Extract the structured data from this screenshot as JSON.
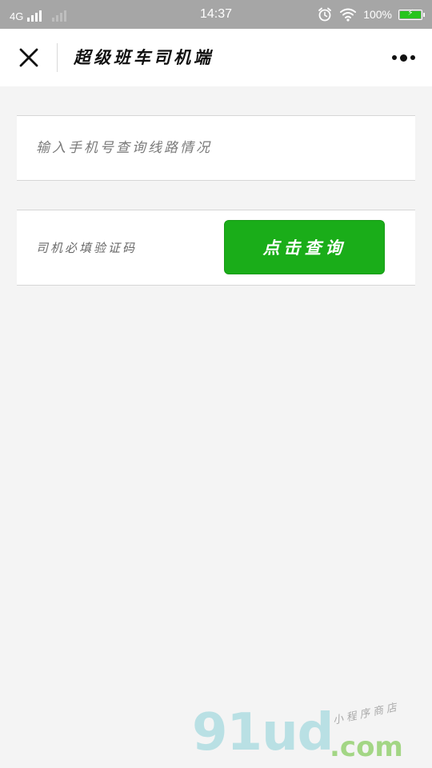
{
  "status_bar": {
    "network": "4G",
    "time": "14:37",
    "battery_percent": "100%",
    "battery_level": 1.0,
    "battery_color": "#27c41d",
    "icons": [
      "signal-icon",
      "signal-icon",
      "alarm-icon",
      "wifi-icon",
      "battery-icon"
    ]
  },
  "nav": {
    "title": "超级班车司机端",
    "close_icon": "close-icon",
    "more_icon": "more-icon"
  },
  "form": {
    "phone_placeholder": "输入手机号查询线路情况",
    "phone_value": "",
    "code_placeholder": "司机必填验证码",
    "code_value": "",
    "query_button_label": "点击查询",
    "button_color": "#1aad19"
  },
  "watermark": {
    "logo_text": "91ud",
    "domain_text": ".com",
    "tagline": "小程序商店"
  }
}
